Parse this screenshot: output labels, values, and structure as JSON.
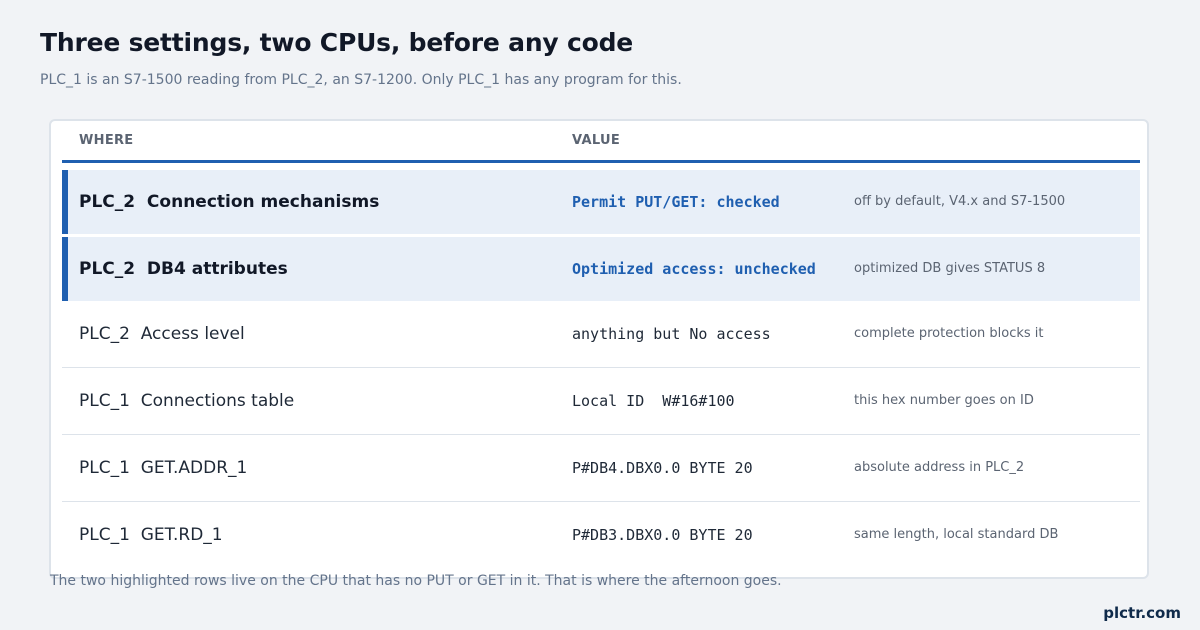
{
  "title": "Three settings, two CPUs, before any code",
  "subtitle": "PLC_1 is an S7-1500 reading from PLC_2, an S7-1200. Only PLC_1 has any program for this.",
  "table": {
    "headers": {
      "where": "WHERE",
      "value": "VALUE"
    },
    "rows": [
      {
        "where": "PLC_2  Connection mechanisms",
        "value": "Permit PUT/GET: checked",
        "note": "off by default, V4.x and S7-1500",
        "highlighted": true
      },
      {
        "where": "PLC_2  DB4 attributes",
        "value": "Optimized access: unchecked",
        "note": "optimized DB gives STATUS 8",
        "highlighted": true
      },
      {
        "where": "PLC_2  Access level",
        "value": "anything but No access",
        "note": "complete protection blocks it",
        "highlighted": false
      },
      {
        "where": "PLC_1  Connections table",
        "value": "Local ID  W#16#100",
        "note": "this hex number goes on ID",
        "highlighted": false
      },
      {
        "where": "PLC_1  GET.ADDR_1",
        "value": "P#DB4.DBX0.0 BYTE 20",
        "note": "absolute address in PLC_2",
        "highlighted": false
      },
      {
        "where": "PLC_1  GET.RD_1",
        "value": "P#DB3.DBX0.0 BYTE 20",
        "note": "same length, local standard DB",
        "highlighted": false
      }
    ]
  },
  "footer": "The two highlighted rows live on the CPU that has no PUT or GET in it. That is where the afternoon goes.",
  "brand": "plctr.com",
  "colors": {
    "accent": "#1f5fb0",
    "highlight_bg": "#e8eff8",
    "page_bg": "#f1f3f6"
  }
}
